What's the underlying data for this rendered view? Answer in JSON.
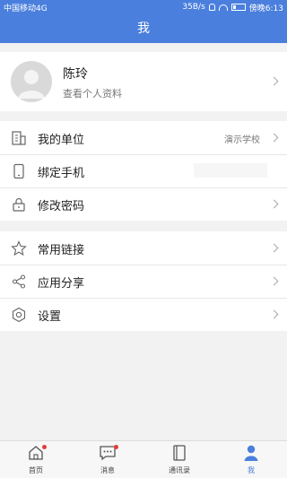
{
  "status_bar": {
    "carrier": "中国移动4G",
    "net_speed": "35B/s",
    "time": "傍晚6:13"
  },
  "header": {
    "title": "我"
  },
  "profile": {
    "name": "陈玲",
    "subtitle": "查看个人资料"
  },
  "group1": [
    {
      "label": "我的单位",
      "value": "演示学校",
      "icon": "building-icon"
    },
    {
      "label": "绑定手机",
      "value": "",
      "icon": "phone-icon"
    },
    {
      "label": "修改密码",
      "value": "",
      "icon": "lock-icon"
    }
  ],
  "group2": [
    {
      "label": "常用链接",
      "icon": "star-icon"
    },
    {
      "label": "应用分享",
      "icon": "share-icon"
    },
    {
      "label": "设置",
      "icon": "gear-icon"
    }
  ],
  "tabbar": {
    "tabs": [
      {
        "label": "首页",
        "icon": "home-icon",
        "badge": true
      },
      {
        "label": "消息",
        "icon": "message-icon",
        "badge": true
      },
      {
        "label": "通讯录",
        "icon": "contacts-icon",
        "badge": false
      },
      {
        "label": "我",
        "icon": "person-icon",
        "badge": false
      }
    ],
    "active": "我"
  },
  "colors": {
    "accent": "#4a7fdd",
    "badge": "#e63b3b"
  }
}
